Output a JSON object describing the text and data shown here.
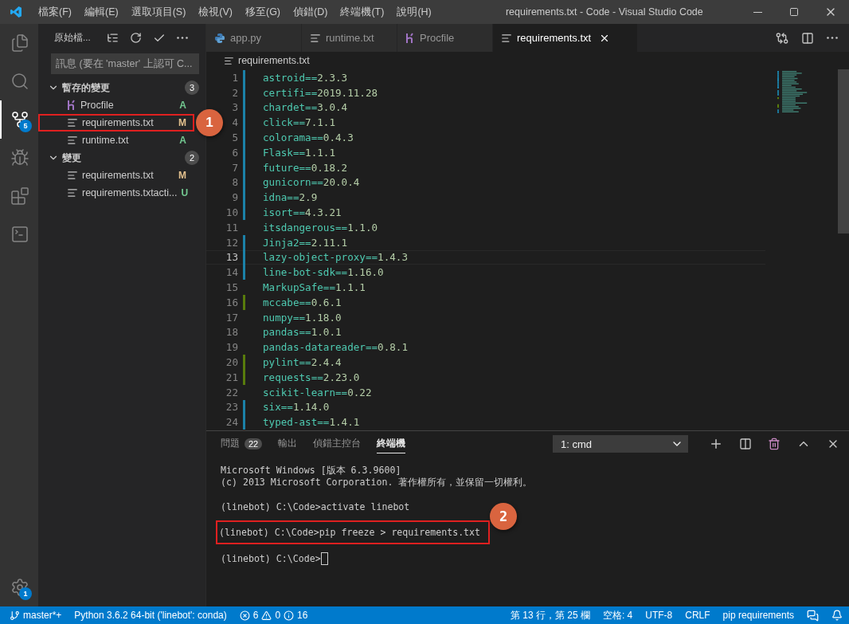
{
  "window": {
    "title": "requirements.txt - Code - Visual Studio Code"
  },
  "menu": [
    "檔案(F)",
    "編輯(E)",
    "選取項目(S)",
    "檢視(V)",
    "移至(G)",
    "偵錯(D)",
    "終端機(T)",
    "說明(H)"
  ],
  "activity_bar": {
    "items": [
      {
        "kind": "explorer",
        "selected": false
      },
      {
        "kind": "search",
        "selected": false
      },
      {
        "kind": "scm",
        "selected": true,
        "badge": "5"
      },
      {
        "kind": "debug",
        "selected": false
      },
      {
        "kind": "extensions",
        "selected": false
      },
      {
        "kind": "terminal",
        "selected": false
      }
    ],
    "settings_badge": "1"
  },
  "sidebar": {
    "title": "原始檔...",
    "message_placeholder": "訊息 (要在 'master' 上認可 C...",
    "groups": [
      {
        "label": "暫存的變更",
        "count": "3",
        "expanded": true,
        "items": [
          {
            "name": "Procfile",
            "kind": "heroku",
            "status": "A",
            "color": "#73c991",
            "marked": false
          },
          {
            "name": "requirements.txt",
            "kind": "text",
            "status": "M",
            "color": "#e2c08d",
            "marked": true,
            "callout": "1"
          },
          {
            "name": "runtime.txt",
            "kind": "text",
            "status": "A",
            "color": "#73c991",
            "marked": false
          }
        ]
      },
      {
        "label": "變更",
        "count": "2",
        "expanded": true,
        "items": [
          {
            "name": "requirements.txt",
            "kind": "text",
            "status": "M",
            "color": "#e2c08d",
            "marked": false
          },
          {
            "name": "requirements.txtacti...",
            "kind": "text",
            "status": "U",
            "color": "#73c991",
            "marked": false
          }
        ]
      }
    ]
  },
  "editor": {
    "tabs": [
      {
        "label": "app.py",
        "kind": "python",
        "selected": false
      },
      {
        "label": "runtime.txt",
        "kind": "text",
        "selected": false
      },
      {
        "label": "Procfile",
        "kind": "heroku",
        "selected": false
      },
      {
        "label": "requirements.txt",
        "kind": "text",
        "selected": true
      }
    ],
    "breadcrumb": "requirements.txt",
    "lines": [
      {
        "number": "1",
        "text": "astroid==2.3.3",
        "kind": "modified",
        "current": false
      },
      {
        "number": "2",
        "text": "certifi==2019.11.28",
        "kind": "modified",
        "current": false
      },
      {
        "number": "3",
        "text": "chardet==3.0.4",
        "kind": "modified",
        "current": false
      },
      {
        "number": "4",
        "text": "click==7.1.1",
        "kind": "modified",
        "current": false
      },
      {
        "number": "5",
        "text": "colorama==0.4.3",
        "kind": "modified",
        "current": false
      },
      {
        "number": "6",
        "text": "Flask==1.1.1",
        "kind": "modified",
        "current": false
      },
      {
        "number": "7",
        "text": "future==0.18.2",
        "kind": "modified",
        "current": false
      },
      {
        "number": "8",
        "text": "gunicorn==20.0.4",
        "kind": "modified",
        "current": false
      },
      {
        "number": "9",
        "text": "idna==2.9",
        "kind": "modified",
        "current": false
      },
      {
        "number": "10",
        "text": "isort==4.3.21",
        "kind": "modified",
        "current": false
      },
      {
        "number": "11",
        "text": "itsdangerous==1.1.0",
        "kind": "plain",
        "current": false
      },
      {
        "number": "12",
        "text": "Jinja2==2.11.1",
        "kind": "modified",
        "current": false
      },
      {
        "number": "13",
        "text": "lazy-object-proxy==1.4.3",
        "kind": "modified",
        "current": true
      },
      {
        "number": "14",
        "text": "line-bot-sdk==1.16.0",
        "kind": "modified",
        "current": false
      },
      {
        "number": "15",
        "text": "MarkupSafe==1.1.1",
        "kind": "plain",
        "current": false
      },
      {
        "number": "16",
        "text": "mccabe==0.6.1",
        "kind": "added",
        "current": false
      },
      {
        "number": "17",
        "text": "numpy==1.18.0",
        "kind": "plain",
        "current": false
      },
      {
        "number": "18",
        "text": "pandas==1.0.1",
        "kind": "plain",
        "current": false
      },
      {
        "number": "19",
        "text": "pandas-datareader==0.8.1",
        "kind": "plain",
        "current": false
      },
      {
        "number": "20",
        "text": "pylint==2.4.4",
        "kind": "added",
        "current": false
      },
      {
        "number": "21",
        "text": "requests==2.23.0",
        "kind": "added",
        "current": false
      },
      {
        "number": "22",
        "text": "scikit-learn==0.22",
        "kind": "plain",
        "current": false
      },
      {
        "number": "23",
        "text": "six==1.14.0",
        "kind": "modified",
        "current": false
      },
      {
        "number": "24",
        "text": "typed-ast==1.4.1",
        "kind": "modified",
        "current": false
      }
    ]
  },
  "panel": {
    "tabs": [
      {
        "label": "問題",
        "badge": "22",
        "selected": false
      },
      {
        "label": "輸出",
        "selected": false
      },
      {
        "label": "偵錯主控台",
        "selected": false
      },
      {
        "label": "終端機",
        "selected": true
      }
    ],
    "terminal_select": "1: cmd",
    "blocks": [
      [
        {
          "text": "Microsoft Windows [版本 6.3.9600]",
          "marked": false,
          "cursor": false
        },
        {
          "text": "(c) 2013 Microsoft Corporation. 著作權所有，並保留一切權利。",
          "marked": false,
          "cursor": false
        }
      ],
      [
        {
          "text": "(linebot) C:\\Code>activate linebot",
          "marked": false,
          "cursor": false
        }
      ],
      [
        {
          "text": "(linebot) C:\\Code>pip freeze > requirements.txt",
          "marked": true,
          "cursor": false,
          "callout": "2"
        }
      ],
      [
        {
          "text": "(linebot) C:\\Code>",
          "marked": false,
          "cursor": true
        }
      ]
    ]
  },
  "status_bar": {
    "branch": "master*+",
    "interpreter": "Python 3.6.2 64-bit ('linebot': conda)",
    "errors": "6",
    "warnings": "0",
    "infos": "16",
    "right": [
      "第 13 行，第 25 欄",
      "空格: 4",
      "UTF-8",
      "CRLF",
      "pip requirements"
    ]
  }
}
